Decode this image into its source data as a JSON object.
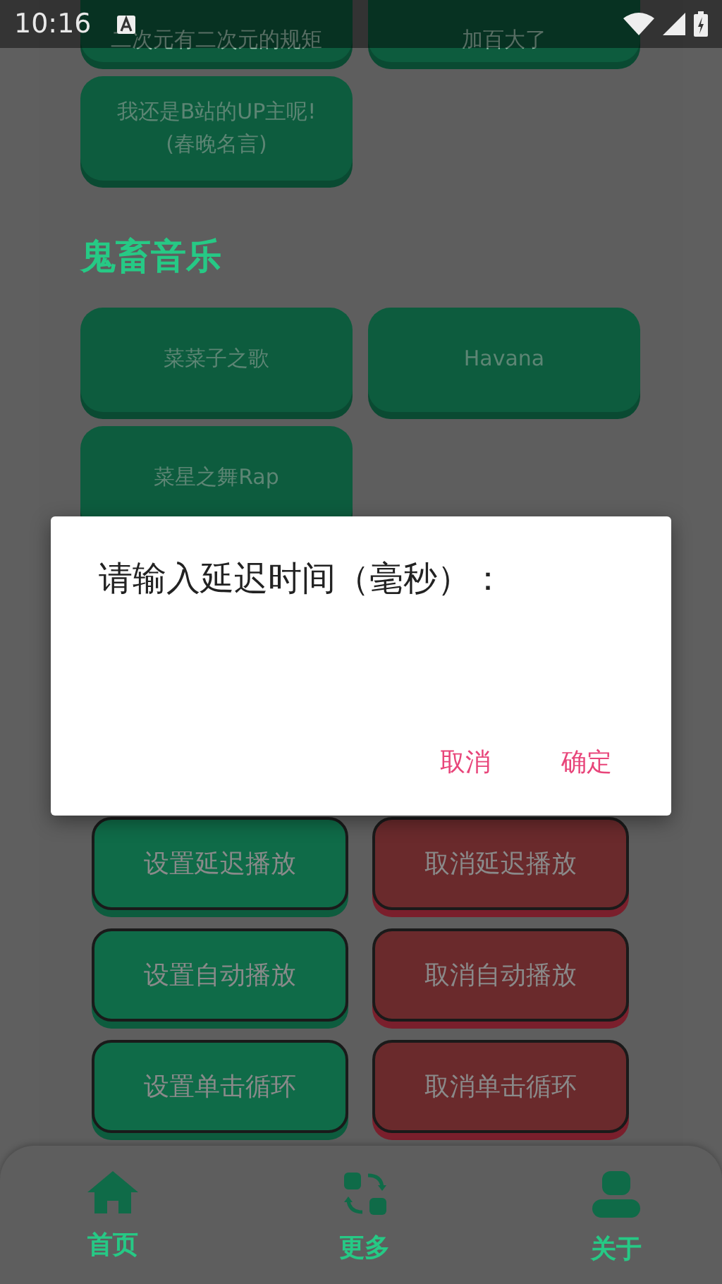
{
  "status_bar": {
    "time": "10:16"
  },
  "top_buttons": [
    {
      "lines": [
        "二次元有二次元的规矩"
      ]
    },
    {
      "lines": [
        "加百大了"
      ]
    },
    {
      "lines": [
        "我还是B站的UP主呢!",
        "(春晚名言)"
      ]
    }
  ],
  "section": {
    "title": "鬼畜音乐"
  },
  "music_buttons": [
    {
      "label": "菜菜子之歌"
    },
    {
      "label": "Havana"
    },
    {
      "label": "菜星之舞Rap"
    }
  ],
  "control_buttons": [
    {
      "label": "设置延迟播放",
      "kind": "set"
    },
    {
      "label": "取消延迟播放",
      "kind": "cancel"
    },
    {
      "label": "设置自动播放",
      "kind": "set"
    },
    {
      "label": "取消自动播放",
      "kind": "cancel"
    },
    {
      "label": "设置单击循环",
      "kind": "set"
    },
    {
      "label": "取消单击循环",
      "kind": "cancel"
    }
  ],
  "dialog": {
    "title": "请输入延迟时间（毫秒）：",
    "buttons": [
      "取消",
      "确定"
    ]
  },
  "nav": [
    {
      "label": "首页"
    },
    {
      "label": "更多"
    },
    {
      "label": "关于"
    }
  ]
}
